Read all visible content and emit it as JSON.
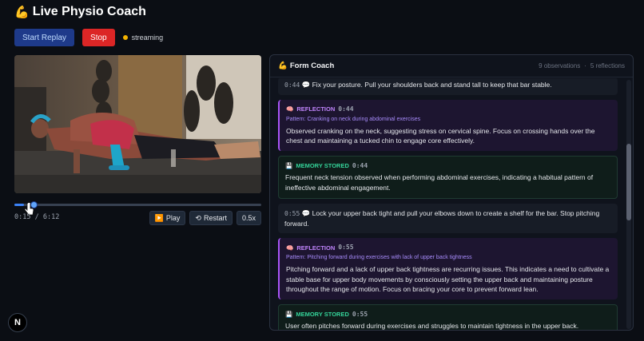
{
  "header": {
    "emoji": "💪",
    "title": "Live Physio Coach"
  },
  "controls": {
    "start_label": "Start Replay",
    "stop_label": "Stop",
    "status_text": "streaming"
  },
  "player": {
    "current_time": "0:15",
    "duration": "6:12",
    "progress": 0.04,
    "play_label": "Play",
    "play_icon": "▶️",
    "restart_label": "Restart",
    "restart_icon": "⟲",
    "speed_label": "0.5x"
  },
  "panel": {
    "emoji": "💪",
    "title": "Form Coach",
    "observations": "9 observations",
    "reflections": "5 reflections",
    "separator": "·"
  },
  "feed": [
    {
      "type": "tip",
      "time": "0:44",
      "text": "Fix your posture. Pull your shoulders back and stand tall to keep that bar stable."
    },
    {
      "type": "reflection",
      "tag": "REFLECTION",
      "time": "0:44",
      "pattern": "Pattern: Cranking on neck during abdominal exercises",
      "text": "Observed cranking on the neck, suggesting stress on cervical spine. Focus on crossing hands over the chest and maintaining a tucked chin to engage core effectively."
    },
    {
      "type": "memory",
      "tag": "MEMORY STORED",
      "time": "0:44",
      "text": "Frequent neck tension observed when performing abdominal exercises, indicating a habitual pattern of ineffective abdominal engagement."
    },
    {
      "type": "tip",
      "time": "0:55",
      "text": "Lock your upper back tight and pull your elbows down to create a shelf for the bar. Stop pitching forward."
    },
    {
      "type": "reflection",
      "tag": "REFLECTION",
      "time": "0:55",
      "pattern": "Pattern: Pitching forward during exercises with lack of upper back tightness",
      "text": "Pitching forward and a lack of upper back tightness are recurring issues. This indicates a need to cultivate a stable base for upper body movements by consciously setting the upper back and maintaining posture throughout the range of motion. Focus on bracing your core to prevent forward lean."
    },
    {
      "type": "memory",
      "tag": "MEMORY STORED",
      "time": "0:55",
      "text": "User often pitches forward during exercises and struggles to maintain tightness in the upper back."
    }
  ],
  "colors": {
    "accent_blue": "#1e3a8a",
    "stop_red": "#dc2626",
    "status_yellow": "#f5b400",
    "reflection_purple": "#c084fc",
    "memory_green": "#34d399"
  },
  "icons": {
    "speech": "💬",
    "brain": "🧠",
    "memory": "💾",
    "next_logo": "N"
  }
}
